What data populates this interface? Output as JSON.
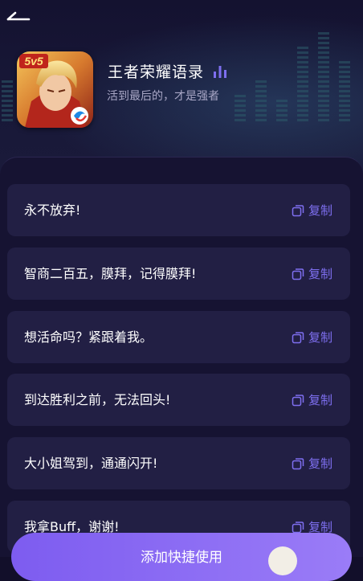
{
  "header": {
    "title": "王者荣耀语录",
    "subtitle": "活到最后的，才是强者",
    "icon_badge": "5v5"
  },
  "quotes": [
    {
      "text": "永不放弃!",
      "copy_label": "复制"
    },
    {
      "text": "智商二百五，膜拜，记得膜拜!",
      "copy_label": "复制"
    },
    {
      "text": "想活命吗？紧跟着我。",
      "copy_label": "复制"
    },
    {
      "text": "到达胜利之前，无法回头!",
      "copy_label": "复制"
    },
    {
      "text": "大小姐驾到，通通闪开!",
      "copy_label": "复制"
    },
    {
      "text": "我拿Buff，谢谢!",
      "copy_label": "复制"
    }
  ],
  "bottom_button": {
    "label": "添加快捷使用"
  },
  "colors": {
    "accent": "#7e6ff0",
    "background": "#120f2a",
    "card": "#221f44",
    "button_start": "#7d5cf0",
    "button_end": "#9a7cf7"
  }
}
